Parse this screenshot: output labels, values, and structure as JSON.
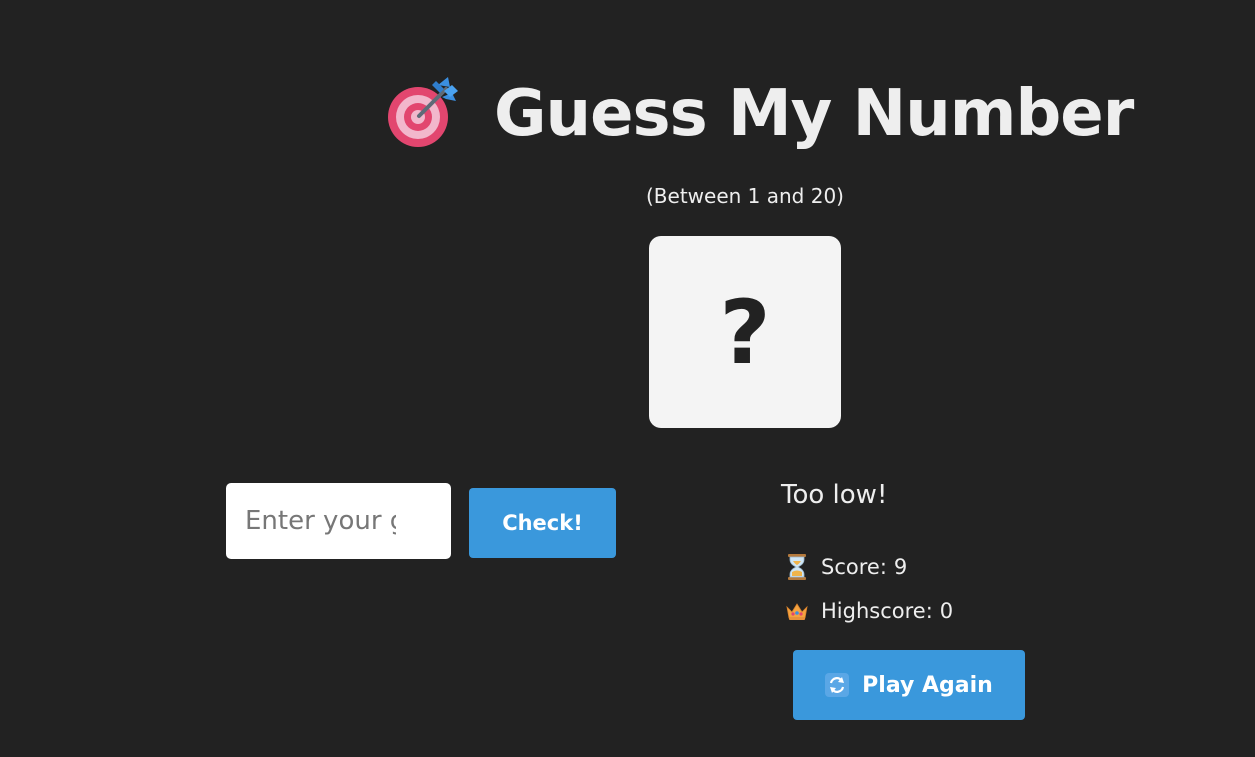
{
  "header": {
    "icon": "target-icon",
    "title": "Guess My Number",
    "range_hint": "(Between 1 and 20)"
  },
  "secret": {
    "display": "?"
  },
  "guess": {
    "placeholder": "Enter your guess",
    "value": "",
    "check_label": "Check!"
  },
  "status": {
    "message": "Too low!",
    "score_icon": "hourglass-icon",
    "score_label": "Score:",
    "score_value": "9",
    "highscore_icon": "crown-icon",
    "highscore_label": "Highscore:",
    "highscore_value": "0"
  },
  "actions": {
    "again_icon": "refresh-icon",
    "again_label": "Play Again"
  },
  "colors": {
    "background": "#222222",
    "text": "#eeeeee",
    "box": "#f4f4f4",
    "accent": "#3a98dc"
  }
}
